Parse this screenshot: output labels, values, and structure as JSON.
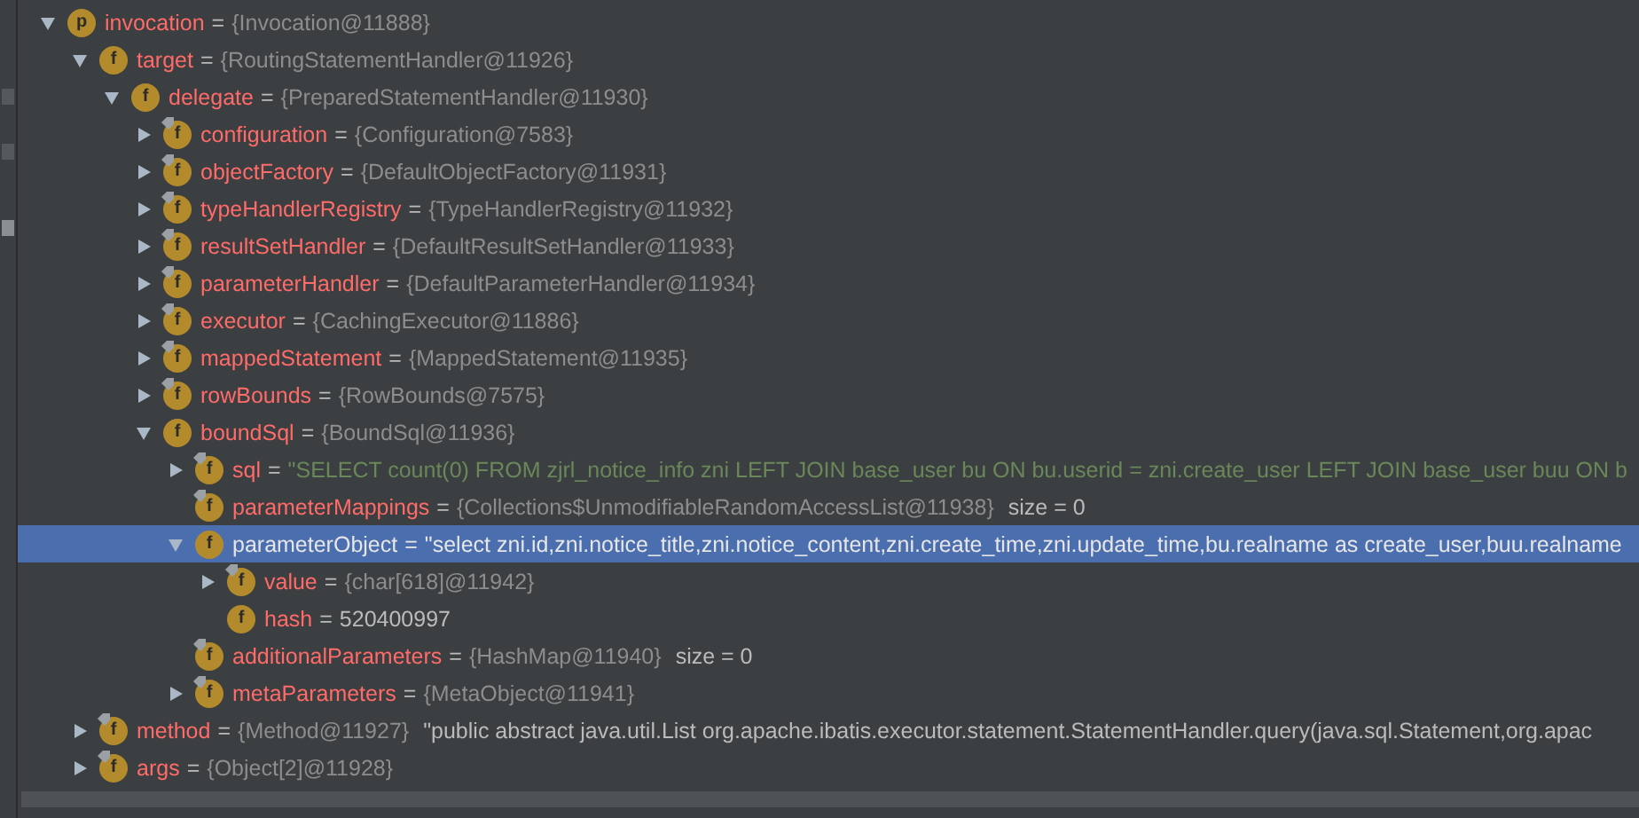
{
  "tree": [
    {
      "badge": "p",
      "final": false,
      "name": "invocation",
      "op": "=",
      "value": "{Invocation@11888}",
      "selected": false,
      "expanded": true,
      "children": [
        {
          "badge": "f",
          "final": false,
          "name": "target",
          "op": "=",
          "value": "{RoutingStatementHandler@11926}",
          "selected": false,
          "expanded": true,
          "children": [
            {
              "badge": "f",
              "final": false,
              "name": "delegate",
              "op": "=",
              "value": "{PreparedStatementHandler@11930}",
              "selected": false,
              "expanded": true,
              "children": [
                {
                  "badge": "f",
                  "final": true,
                  "name": "configuration",
                  "op": "=",
                  "value": "{Configuration@7583}",
                  "selected": false,
                  "expanded": false
                },
                {
                  "badge": "f",
                  "final": true,
                  "name": "objectFactory",
                  "op": "=",
                  "value": "{DefaultObjectFactory@11931}",
                  "selected": false,
                  "expanded": false
                },
                {
                  "badge": "f",
                  "final": true,
                  "name": "typeHandlerRegistry",
                  "op": "=",
                  "value": "{TypeHandlerRegistry@11932}",
                  "selected": false,
                  "expanded": false
                },
                {
                  "badge": "f",
                  "final": true,
                  "name": "resultSetHandler",
                  "op": "=",
                  "value": "{DefaultResultSetHandler@11933}",
                  "selected": false,
                  "expanded": false
                },
                {
                  "badge": "f",
                  "final": true,
                  "name": "parameterHandler",
                  "op": "=",
                  "value": "{DefaultParameterHandler@11934}",
                  "selected": false,
                  "expanded": false
                },
                {
                  "badge": "f",
                  "final": true,
                  "name": "executor",
                  "op": "=",
                  "value": "{CachingExecutor@11886}",
                  "selected": false,
                  "expanded": false
                },
                {
                  "badge": "f",
                  "final": true,
                  "name": "mappedStatement",
                  "op": "=",
                  "value": "{MappedStatement@11935}",
                  "selected": false,
                  "expanded": false
                },
                {
                  "badge": "f",
                  "final": true,
                  "name": "rowBounds",
                  "op": "=",
                  "value": "{RowBounds@7575}",
                  "selected": false,
                  "expanded": false
                },
                {
                  "badge": "f",
                  "final": false,
                  "name": "boundSql",
                  "op": "=",
                  "value": "{BoundSql@11936}",
                  "selected": false,
                  "expanded": true,
                  "children": [
                    {
                      "badge": "f",
                      "final": true,
                      "name": "sql",
                      "op": "=",
                      "string": "\"SELECT count(0) FROM zjrl_notice_info zni LEFT JOIN base_user bu ON bu.userid = zni.create_user LEFT JOIN base_user buu ON b",
                      "selected": false,
                      "expanded": false
                    },
                    {
                      "badge": "f",
                      "final": true,
                      "name": "parameterMappings",
                      "op": "=",
                      "value": "{Collections$UnmodifiableRandomAccessList@11938}",
                      "extra": "size = 0",
                      "selected": false
                    },
                    {
                      "badge": "f",
                      "final": false,
                      "name": "parameterObject",
                      "op": "=",
                      "plain": "\"select zni.id,zni.notice_title,zni.notice_content,zni.create_time,zni.update_time,bu.realname as create_user,buu.realname",
                      "selected": true,
                      "expanded": true,
                      "children": [
                        {
                          "badge": "f",
                          "final": true,
                          "name": "value",
                          "op": "=",
                          "value": "{char[618]@11942}",
                          "selected": false,
                          "expanded": false
                        },
                        {
                          "badge": "f",
                          "final": false,
                          "name": "hash",
                          "op": "=",
                          "plain": "520400997",
                          "selected": false
                        }
                      ]
                    },
                    {
                      "badge": "f",
                      "final": true,
                      "name": "additionalParameters",
                      "op": "=",
                      "value": "{HashMap@11940}",
                      "extra": "size = 0",
                      "selected": false
                    },
                    {
                      "badge": "f",
                      "final": true,
                      "name": "metaParameters",
                      "op": "=",
                      "value": "{MetaObject@11941}",
                      "selected": false,
                      "expanded": false
                    }
                  ]
                }
              ]
            }
          ]
        },
        {
          "badge": "f",
          "final": true,
          "name": "method",
          "op": "=",
          "value": "{Method@11927}",
          "extra": "\"public abstract java.util.List org.apache.ibatis.executor.statement.StatementHandler.query(java.sql.Statement,org.apac",
          "selected": false,
          "expanded": false
        },
        {
          "badge": "f",
          "final": true,
          "name": "args",
          "op": "=",
          "value": "{Object[2]@11928}",
          "selected": false,
          "expanded": false
        }
      ]
    }
  ]
}
